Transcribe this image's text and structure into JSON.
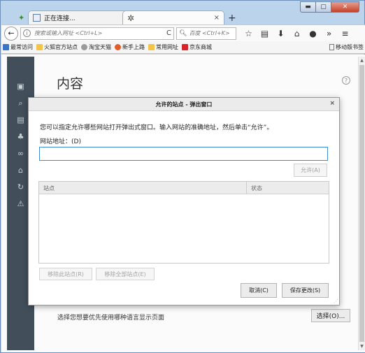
{
  "window": {
    "minimize": "▬",
    "maximize": "▢",
    "close": "✕"
  },
  "tabs": [
    {
      "label": "正在连接...",
      "close": "×"
    },
    {
      "label": "",
      "close": "×"
    }
  ],
  "newtab": "+",
  "navbar": {
    "back": "←",
    "url_placeholder": "搜索或输入网址 <Ctrl+L>",
    "reload": "C",
    "search_placeholder": "百度 <Ctrl+K>",
    "search_icon": "search-icon",
    "icons": [
      "star-icon",
      "reading-list-icon",
      "download-icon",
      "home-icon",
      "chat-icon",
      "overflow-icon",
      "menu-icon"
    ]
  },
  "bookmarks": {
    "items": [
      {
        "label": "最常访问",
        "color": "#3b74c4"
      },
      {
        "label": "火狐官方站点",
        "color": "#f2c54a"
      },
      {
        "label": "淘宝天猫",
        "color": "#9a9a9a"
      },
      {
        "label": "新手上路",
        "color": "#e05e2a"
      },
      {
        "label": "常用网址",
        "color": "#f2c54a"
      },
      {
        "label": "京东商城",
        "color": "#d8232a"
      }
    ],
    "mobile": "移动版书签"
  },
  "page": {
    "title": "内容",
    "help": "?",
    "lang_text": "选择您想要优先使用哪种语言显示页面",
    "lang_button": "选择(O)..."
  },
  "dialog": {
    "title": "允许的站点 - 弹出窗口",
    "close": "×",
    "description": "您可以指定允许哪些网站打开弹出式窗口。输入网站的准确地址，然后单击“允许”。",
    "address_label": "网站地址：(D)",
    "allow_button": "允许(A)",
    "col_site": "站点",
    "col_status": "状态",
    "remove_button": "移除此站点(R)",
    "remove_all_button": "移除全部站点(E)",
    "cancel_button": "取消(C)",
    "save_button": "保存更改(S)"
  },
  "colors": {
    "sidebar": "#424f5a",
    "input_focus": "#3f8bd4"
  }
}
